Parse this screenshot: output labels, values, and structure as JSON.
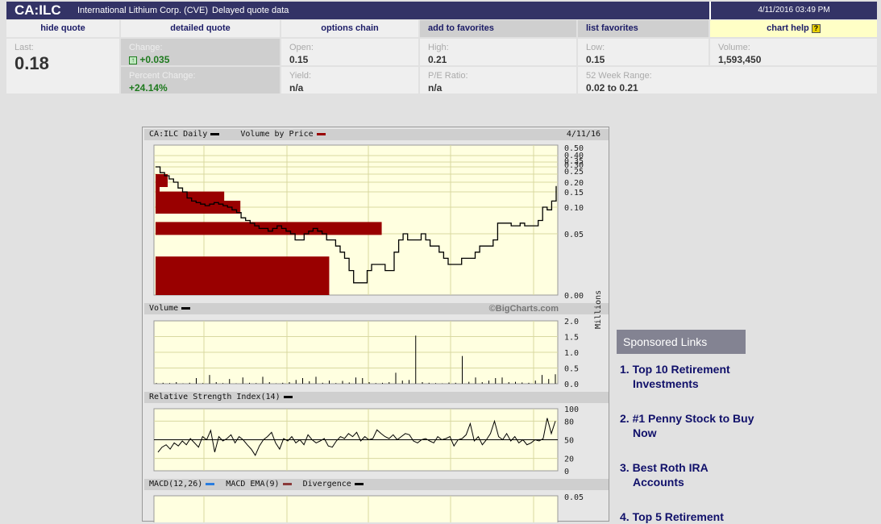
{
  "header": {
    "symbol": "CA:ILC",
    "company": "International Lithium Corp. (CVE)",
    "delay_note": "Delayed quote data",
    "datetime": "4/11/2016 03:49 PM"
  },
  "nav": [
    "hide quote",
    "detailed quote",
    "options chain",
    "add to favorites",
    "list favorites",
    "chart help"
  ],
  "quote": {
    "last_label": "Last:",
    "last": "0.18",
    "change_label": "Change:",
    "change": "+0.035",
    "pct_label": "Percent Change:",
    "pct": "+24.14%",
    "open_label": "Open:",
    "open": "0.15",
    "yield_label": "Yield:",
    "yield": "n/a",
    "high_label": "High:",
    "high": "0.21",
    "pe_label": "P/E Ratio:",
    "pe": "n/a",
    "low_label": "Low:",
    "low": "0.15",
    "range_label": "52 Week Range:",
    "range": "0.02 to 0.21",
    "volume_label": "Volume:",
    "volume": "1,593,450"
  },
  "colors": {
    "header": "#333366",
    "plot_bg": "#ffffe0",
    "vbp": "#990000",
    "up": "#1e7a1e"
  },
  "chart": {
    "price_title": "CA:ILC Daily",
    "vbp_title": "Volume by Price",
    "date": "4/11/16",
    "copyright": "©BigCharts.com",
    "volume_title": "Volume",
    "volume_unit": "Millions",
    "rsi_title": "Relative Strength Index(14)",
    "macd_title": "MACD(12,26)",
    "macd_ema": "MACD EMA(9)",
    "divergence": "Divergence",
    "macd_tick": "0.05"
  },
  "chart_data": {
    "type": "line",
    "price_ticks": [
      "0.50",
      "0.40",
      "0.35",
      "0.30",
      "0.25",
      "0.20",
      "0.15",
      "0.10",
      "0.05",
      "0.00"
    ],
    "price_series": [
      0.3,
      0.26,
      0.24,
      0.22,
      0.2,
      0.17,
      0.15,
      0.13,
      0.12,
      0.115,
      0.11,
      0.105,
      0.11,
      0.115,
      0.11,
      0.105,
      0.1,
      0.095,
      0.09,
      0.08,
      0.075,
      0.07,
      0.065,
      0.06,
      0.06,
      0.055,
      0.06,
      0.065,
      0.06,
      0.055,
      0.05,
      0.045,
      0.045,
      0.05,
      0.055,
      0.06,
      0.055,
      0.05,
      0.045,
      0.045,
      0.04,
      0.035,
      0.03,
      0.02,
      0.01,
      0.01,
      0.01,
      0.02,
      0.025,
      0.025,
      0.025,
      0.02,
      0.02,
      0.035,
      0.045,
      0.05,
      0.045,
      0.045,
      0.045,
      0.05,
      0.045,
      0.04,
      0.04,
      0.035,
      0.03,
      0.025,
      0.025,
      0.025,
      0.03,
      0.03,
      0.03,
      0.035,
      0.04,
      0.04,
      0.04,
      0.045,
      0.07,
      0.07,
      0.07,
      0.065,
      0.065,
      0.07,
      0.065,
      0.065,
      0.065,
      0.075,
      0.1,
      0.095,
      0.12,
      0.18
    ],
    "volume_by_price": [
      {
        "price": 0.21,
        "rel": 0.03
      },
      {
        "price": 0.17,
        "rel": 0.01
      },
      {
        "price": 0.13,
        "rel": 0.17
      },
      {
        "price": 0.1,
        "rel": 0.21
      },
      {
        "price": 0.06,
        "rel": 0.56
      },
      {
        "price": 0.015,
        "rel": 0.43
      }
    ],
    "volume_ticks": [
      "2.0",
      "1.5",
      "1.0",
      "0.5",
      "0.0"
    ],
    "volume_millions": [
      0.02,
      0.03,
      0.02,
      0.05,
      0.01,
      0.03,
      0.18,
      0.02,
      0.28,
      0.05,
      0.02,
      0.15,
      0.01,
      0.2,
      0.03,
      0.02,
      0.22,
      0.05,
      0.01,
      0.03,
      0.05,
      0.12,
      0.18,
      0.08,
      0.22,
      0.03,
      0.1,
      0.02,
      0.09,
      0.04,
      0.2,
      0.18,
      0.05,
      0.02,
      0.03,
      0.05,
      0.35,
      0.1,
      0.12,
      1.53,
      0.05,
      0.03,
      0.02,
      0.01,
      0.04,
      0.03,
      0.88,
      0.06,
      0.2,
      0.05,
      0.1,
      0.18,
      0.2,
      0.05,
      0.06,
      0.04,
      0.03,
      0.1,
      0.28,
      0.15,
      0.3
    ],
    "rsi_ticks": [
      "100",
      "80",
      "50",
      "20",
      "0"
    ],
    "rsi": [
      30,
      38,
      42,
      35,
      45,
      40,
      48,
      42,
      52,
      45,
      38,
      55,
      50,
      65,
      30,
      55,
      48,
      52,
      58,
      45,
      55,
      50,
      42,
      35,
      25,
      40,
      50,
      55,
      62,
      45,
      35,
      52,
      48,
      55,
      45,
      50,
      42,
      58,
      50,
      45,
      48,
      52,
      40,
      38,
      48,
      55,
      52,
      60,
      55,
      62,
      48,
      55,
      50,
      52,
      66,
      60,
      55,
      52,
      58,
      50,
      55,
      60,
      58,
      48,
      45,
      50,
      52,
      48,
      45,
      55,
      50,
      52,
      55,
      40,
      50,
      52,
      58,
      76,
      48,
      55,
      42,
      50,
      60,
      80,
      55,
      50,
      60,
      48,
      55,
      45,
      50,
      42,
      45,
      50,
      48,
      52,
      85,
      60,
      80
    ]
  },
  "sponsored": {
    "title": "Sponsored Links",
    "links": [
      "1. Top 10 Retirement Investments",
      "2. #1 Penny Stock to Buy Now",
      "3. Best Roth IRA Accounts",
      "4. Top 5 Retirement"
    ]
  }
}
